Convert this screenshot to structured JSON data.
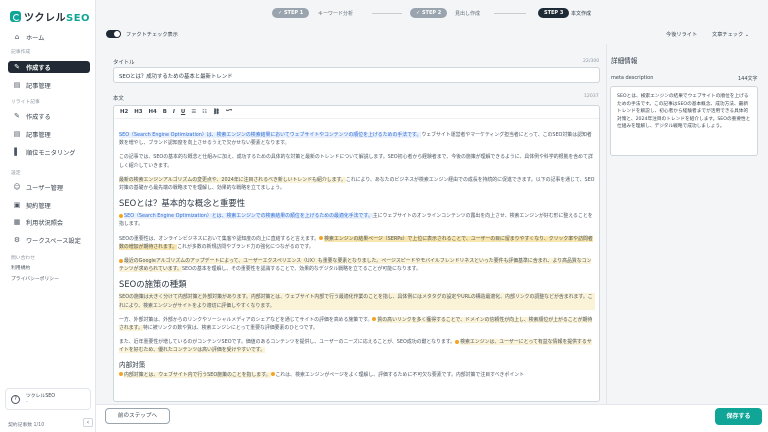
{
  "brand": {
    "name_prefix": "ツクレル",
    "name_suffix": "SEO"
  },
  "sidebar": {
    "home": "ホーム",
    "section_create": "記事作成",
    "create_active": "作成する",
    "create_manage": "記事管理",
    "section_rewrite": "リライト記事",
    "rewrite_create": "作成する",
    "rewrite_manage": "記事管理",
    "ranking": "順位モニタリング",
    "section_settings": "設定",
    "user_manage": "ユーザー管理",
    "contract_manage": "契約管理",
    "usage_status": "利用状況照会",
    "workspace_settings": "ワークスペース設定",
    "section_contact": "問い合わせ",
    "terms": "利用規約",
    "privacy": "プライバシーポリシー",
    "user_name": "ツクレルSEO",
    "user_sub": "-",
    "usage_text": "契約記事数 1/10",
    "collapse_icon": "chevron-left-icon"
  },
  "steps": [
    {
      "badge": "STEP 1",
      "label": "キーワード分析"
    },
    {
      "badge": "STEP 2",
      "label": "見出し作成"
    },
    {
      "badge": "STEP 3",
      "label": "本文作成"
    }
  ],
  "colors": {
    "accent": "#11a597",
    "step_done": "#9aa4ae",
    "step_active": "#1e2a35"
  },
  "toolbar_top": {
    "fact_check_toggle": "ファクトチェック表示",
    "rewrite_action": "今後リライト",
    "fact_check_action": "文章チェック"
  },
  "title_field": {
    "label": "タイトル",
    "count": "22/300",
    "value": "SEOとは？成功するための基本と最新トレンド"
  },
  "body_field": {
    "label": "本文",
    "count": "12037",
    "tools": [
      "H2",
      "H3",
      "H4",
      "B",
      "I",
      "U",
      "☰",
      "☷",
      "⛓",
      "❝❞"
    ],
    "p1a": "SEO（Search Engine Optimization）は、検索エンジンの検索結果においてウェブサイトやコンテンツの順位を上げるための手法です。",
    "p1b": "ウェブサイト運営者やマーケティング担当者にとって、このSEO対策は認知者数を増やし、ブランド認知度を向上させるうえで欠かせない要素となります。",
    "p2": "この記事では、SEOの基本的な概念と仕組みに加え、成功するための具体的な対策と最新のトレンドについて解説します。SEO初心者から経験者まで、今後の施策が理解できるように、具体例や科学的根拠を含めて詳しく紹介していきます。",
    "p3a": "最新の検索エンジンアルゴリズムの変更点や、2024年に注目されるべき新しいトレンドも紹介します。",
    "p3b": "これにより、あなたのビジネスが検索エンジン経由での成長を持続的に促進できます。以下の記事を通じて、SEO対策の基礎から最先端の戦略までを理解し、効果的な戦略を立てましょう。",
    "h2a": "SEOとは？基本的な概念と重要性",
    "p4a": "SEO（Search Engine Optimization）とは、検索エンジンでの検索結果の順位を上げるための最適化手法です。",
    "p4b": "主にウェブサイトのオンラインコンテンツの露出を向上させ、検索エンジンが好む形に整えることを指します。",
    "p5a": "SEOの重要性は、オンラインビジネスにおいて集客や認知度の向上に直結すると言えます。",
    "p5b": "検索エンジンの結果ページ（SERPs）で上位に表示されることで、ユーザーの目に留まりやすくなり、クリック率や訪問者数の増加が期待されます。",
    "p5c": "これが多数の新規訪問やブランド力の強化につながるのです。",
    "p6a": "最近のGoogleアルゴリズムのアップデートによって、ユーザーエクスペリエンス（UX）も重要な要素となりました。",
    "p6b": "ページスピードやモバイルフレンドリネスといった要件も評価基準に含まれ、より高品質なコンテンツが求められています。",
    "p6c": "SEOの基本を理解し、その重要性を認識することで、効果的なデジタル戦略を立てることが可能になります。",
    "h2b": "SEOの施策の種類",
    "p7": "SEOの施策は大きく分けて内部対策と外部対策があります。内部対策とは、ウェブサイト内部で行う最適化作業のことを指し、具体例にはメタタグの設定やURLの構造最適化、内部リンクの調整などが含まれます。これにより、検索エンジンがサイトをより適切に評価しやすくなります。",
    "p8a": "一方、外部対策は、外部からのリンクやソーシャルメディアのシェアなどを通じてサイトの評価を高める施策です。",
    "p8b": "質の高いリンクを多く獲得することで、ドメインの信頼性が向上し、検索順位が上がることが期待されます。",
    "p8c": "特に被リンクの数や質は、検索エンジンにとって重要な評価要素のひとつです。",
    "p9a": "また、近年重要性が増しているのがコンテンツSEOです。価値のあるコンテンツを提供し、ユーザーのニーズに応えることが、SEO成功の鍵となります。",
    "p9b": "検索エンジンは、ユーザーにとって有益な情報を提供するサイトを好むため、優れたコンテンツは高い評価を受けやすいです。",
    "h3a": "内部対策",
    "p10a": "内部対策とは、ウェブサイト内で行うSEO施策のことを指します。",
    "p10b": "これは、検索エンジンがページをよく理解し、評価するために不可欠な要素です。内部対策で注目すべきポイント"
  },
  "panel": {
    "title": "詳細情報",
    "meta_label": "meta description",
    "meta_count": "144文字",
    "meta_text": "SEOとは、検索エンジンの結果でウェブサイトの順位を上げるための手法です。この記事はSEOの基本概念、成功方法、最新トレンドを解説し、初心者から経験者までが活用できる具体的対策と、2024年注目のトレンドを紹介します。SEOの重要性と仕組みを理解し、デジタル戦略で成功しましょう。"
  },
  "footer": {
    "back": "前のステップへ",
    "save": "保存する"
  }
}
